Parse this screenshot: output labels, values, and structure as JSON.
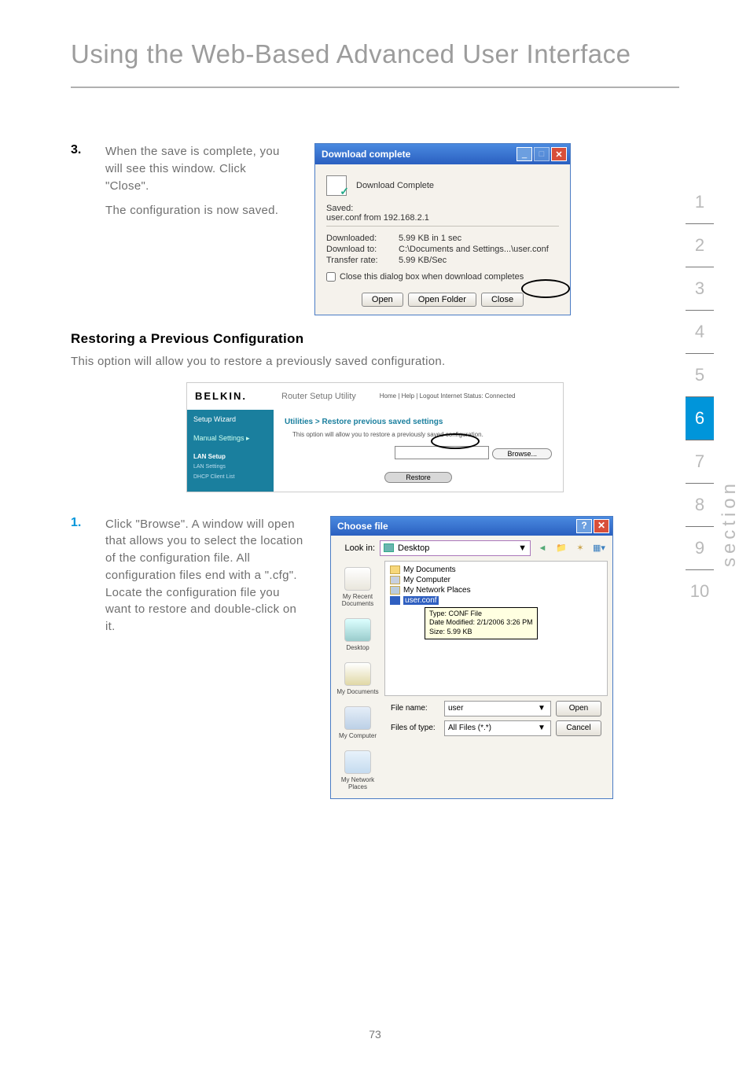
{
  "page": {
    "title": "Using the Web-Based Advanced User Interface",
    "number": "73",
    "section_label": "section"
  },
  "nav": {
    "n1": "1",
    "n2": "2",
    "n3": "3",
    "n4": "4",
    "n5": "5",
    "n6": "6",
    "n7": "7",
    "n8": "8",
    "n9": "9",
    "n10": "10"
  },
  "step3": {
    "num": "3.",
    "p1": "When the save is complete, you will see this window. Click \"Close\".",
    "p2": "The configuration is now saved."
  },
  "dlg1": {
    "title": "Download complete",
    "heading": "Download Complete",
    "saved_label": "Saved:",
    "saved_value": "user.conf from 192.168.2.1",
    "downloaded_k": "Downloaded:",
    "downloaded_v": "5.99 KB in 1 sec",
    "downloadto_k": "Download to:",
    "downloadto_v": "C:\\Documents and Settings...\\user.conf",
    "rate_k": "Transfer rate:",
    "rate_v": "5.99 KB/Sec",
    "cb": "Close this dialog box when download completes",
    "btn_open": "Open",
    "btn_openfolder": "Open Folder",
    "btn_close": "Close"
  },
  "restore": {
    "heading": "Restoring a Previous Configuration",
    "text": "This option will allow you to restore a previously saved configuration."
  },
  "router": {
    "logo": "BELKIN.",
    "title": "Router Setup Utility",
    "links": "Home | Help | Logout   Internet Status: Connected",
    "side_wizard": "Setup Wizard",
    "side_manual": "Manual Settings ▸",
    "side_lan": "LAN Setup",
    "side_lansub1": "LAN Settings",
    "side_lansub2": "DHCP Client List",
    "bread": "Utilities > Restore previous saved settings",
    "sub": "This option will allow you to restore a previously saved configuration.",
    "browse": "Browse...",
    "restore_btn": "Restore"
  },
  "step1": {
    "num": "1.",
    "text": "Click \"Browse\". A window will open that allows you to select the location of the configuration file. All configuration files end with a \".cfg\". Locate the configuration file you want to restore and double-click on it."
  },
  "choose": {
    "title": "Choose file",
    "lookin": "Look in:",
    "lookin_val": "Desktop",
    "place1": "My Recent Documents",
    "place2": "Desktop",
    "place3": "My Documents",
    "place4": "My Computer",
    "place5": "My Network Places",
    "li1": "My Documents",
    "li2": "My Computer",
    "li3": "My Network Places",
    "li4": "user.conf",
    "tt1": "Type: CONF File",
    "tt2": "Date Modified: 2/1/2006 3:26 PM",
    "tt3": "Size: 5.99 KB",
    "fname_l": "File name:",
    "fname_v": "user",
    "ftype_l": "Files of type:",
    "ftype_v": "All Files (*.*)",
    "open": "Open",
    "cancel": "Cancel"
  }
}
